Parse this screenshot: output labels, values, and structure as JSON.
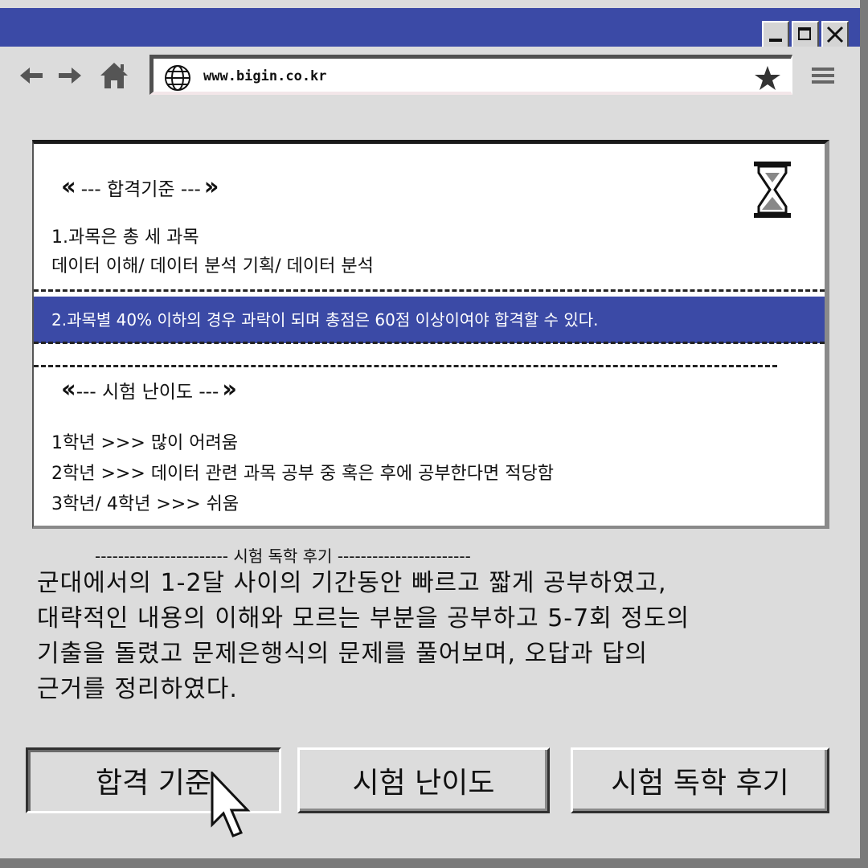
{
  "window": {
    "controls": [
      "minimize",
      "maximize",
      "close"
    ]
  },
  "toolbar": {
    "back_icon": "arrow-left-icon",
    "forward_icon": "arrow-right-icon",
    "home_icon": "home-icon",
    "menu_icon": "hamburger-menu-icon"
  },
  "address_bar": {
    "url": "www.bigin.co.kr",
    "globe_icon": "globe-icon",
    "bookmark_icon": "star-icon"
  },
  "criteria": {
    "title": "--- 합격기준 ---",
    "line1": "1.과목은 총 세 과목",
    "line2": "데이터 이해/ 데이터 분석 기획/ 데이터 분석",
    "highlight": "2.과목별 40% 이하의 경우 과락이 되며 총점은 60점 이상이여야 합격할 수 있다."
  },
  "difficulty": {
    "title": "--- 시험 난이도 ---",
    "rows": [
      "1학년 >>>  많이 어려움",
      "2학년 >>>  데이터 관련 과목 공부 중 혹은 후에 공부한다면 적당함",
      "3학년/ 4학년 >>> 쉬움"
    ]
  },
  "review": {
    "header": "----------------------- 시험 독학 후기 -----------------------",
    "lines": [
      "군대에서의 1-2달 사이의 기간동안 빠르고 짧게 공부하였고,",
      "대략적인 내용의 이해와 모르는 부분을 공부하고 5-7회 정도의",
      "기출을 돌렸고 문제은행식의 문제를 풀어보며, 오답과 답의",
      "근거를 정리하였다."
    ]
  },
  "tabs": [
    {
      "label": "합격 기준",
      "active": true
    },
    {
      "label": "시험 난이도",
      "active": false
    },
    {
      "label": "시험 독학 후기",
      "active": false
    }
  ],
  "colors": {
    "titlebar": "#3b4aa6",
    "highlight": "#3b4aa6",
    "background": "#dcdcdc"
  }
}
